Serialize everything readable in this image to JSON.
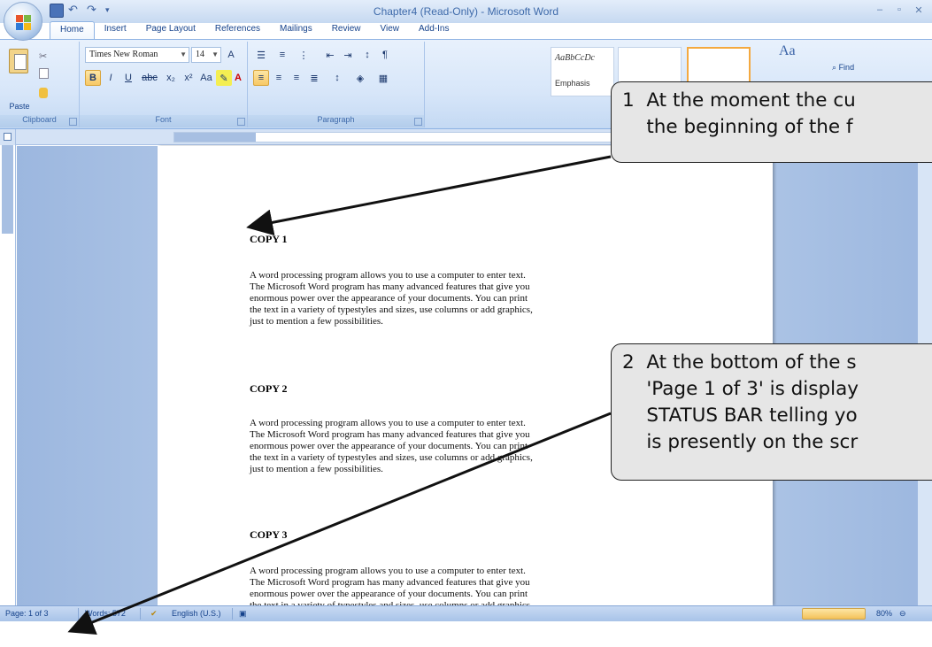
{
  "window": {
    "title": "Chapter4 (Read-Only) - Microsoft Word"
  },
  "ribbon": {
    "tabs": [
      "Home",
      "Insert",
      "Page Layout",
      "References",
      "Mailings",
      "Review",
      "View",
      "Add-Ins"
    ],
    "active_tab": "Home",
    "clipboard": {
      "paste_label": "Paste",
      "group_label": "Clipboard"
    },
    "font": {
      "name": "Times New Roman",
      "size": "14",
      "group_label": "Font"
    },
    "paragraph": {
      "group_label": "Paragraph"
    },
    "styles": {
      "tile1_preview": "AaBbCcDc",
      "tile1_name": "Emphasis"
    },
    "editing": {
      "find_label": "Find"
    }
  },
  "document": {
    "sections": [
      {
        "heading": "COPY 1",
        "lines": [
          "A word processing program allows you to use a computer to enter text.",
          "The Microsoft Word program has many advanced features that give you",
          "enormous power over the appearance of your documents.  You can print",
          "the text in a variety of typestyles and sizes, use columns or add graphics,",
          "just to mention a few possibilities."
        ]
      },
      {
        "heading": "COPY 2",
        "lines": [
          "A word processing program allows you to use a computer to enter text.",
          "The Microsoft Word program has many advanced features that give you",
          "enormous power over the appearance of your documents.  You can print",
          "the text in a variety of typestyles and sizes, use columns or add graphics,",
          "just to mention a few possibilities."
        ]
      },
      {
        "heading": "COPY 3",
        "lines": [
          "A word processing program allows you to use a computer to enter text.",
          "The Microsoft Word program has many advanced features that give you",
          "enormous power over the appearance of your documents.  You can print",
          "the text in a variety of typestyles and sizes, use columns or add graphics,"
        ]
      }
    ]
  },
  "statusbar": {
    "page": "Page: 1 of 3",
    "words": "Words: 572",
    "language": "English (U.S.)",
    "zoom": "80%"
  },
  "callouts": [
    {
      "lines": [
        "1  At the moment the cu",
        "    the beginning of the f"
      ]
    },
    {
      "lines": [
        "2  At the bottom of the s",
        "    'Page 1 of 3' is display",
        "    STATUS BAR telling yo",
        "    is presently on the scr"
      ]
    }
  ],
  "colors": {
    "ribbon_bg": "#d7e6f9",
    "accent": "#15428b",
    "doc_background": "#b5cbe9",
    "callout_bg": "#e6e6e6"
  }
}
